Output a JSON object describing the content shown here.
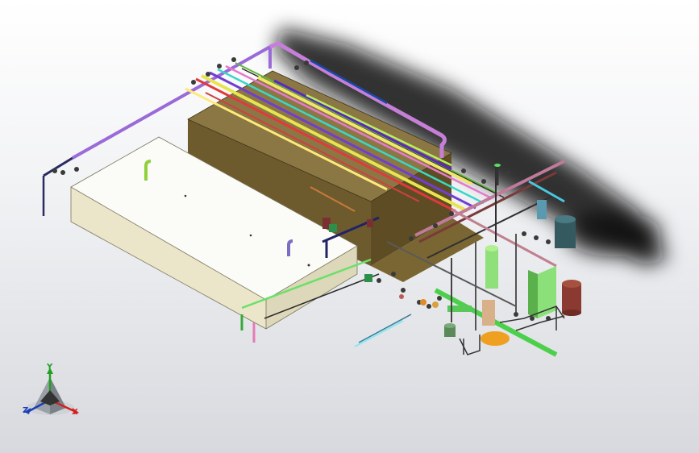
{
  "triad": {
    "y_label": "Y",
    "z_label": "Z",
    "x_label": "X",
    "colors": {
      "x": "#d42020",
      "y": "#1fa01f",
      "z": "#1a3fb5"
    }
  },
  "scene": {
    "icons": [
      "white-tank-icon",
      "brown-tank-icon",
      "pipe-network-icon",
      "pressure-vessel-icon",
      "pump-skid-icon"
    ]
  }
}
